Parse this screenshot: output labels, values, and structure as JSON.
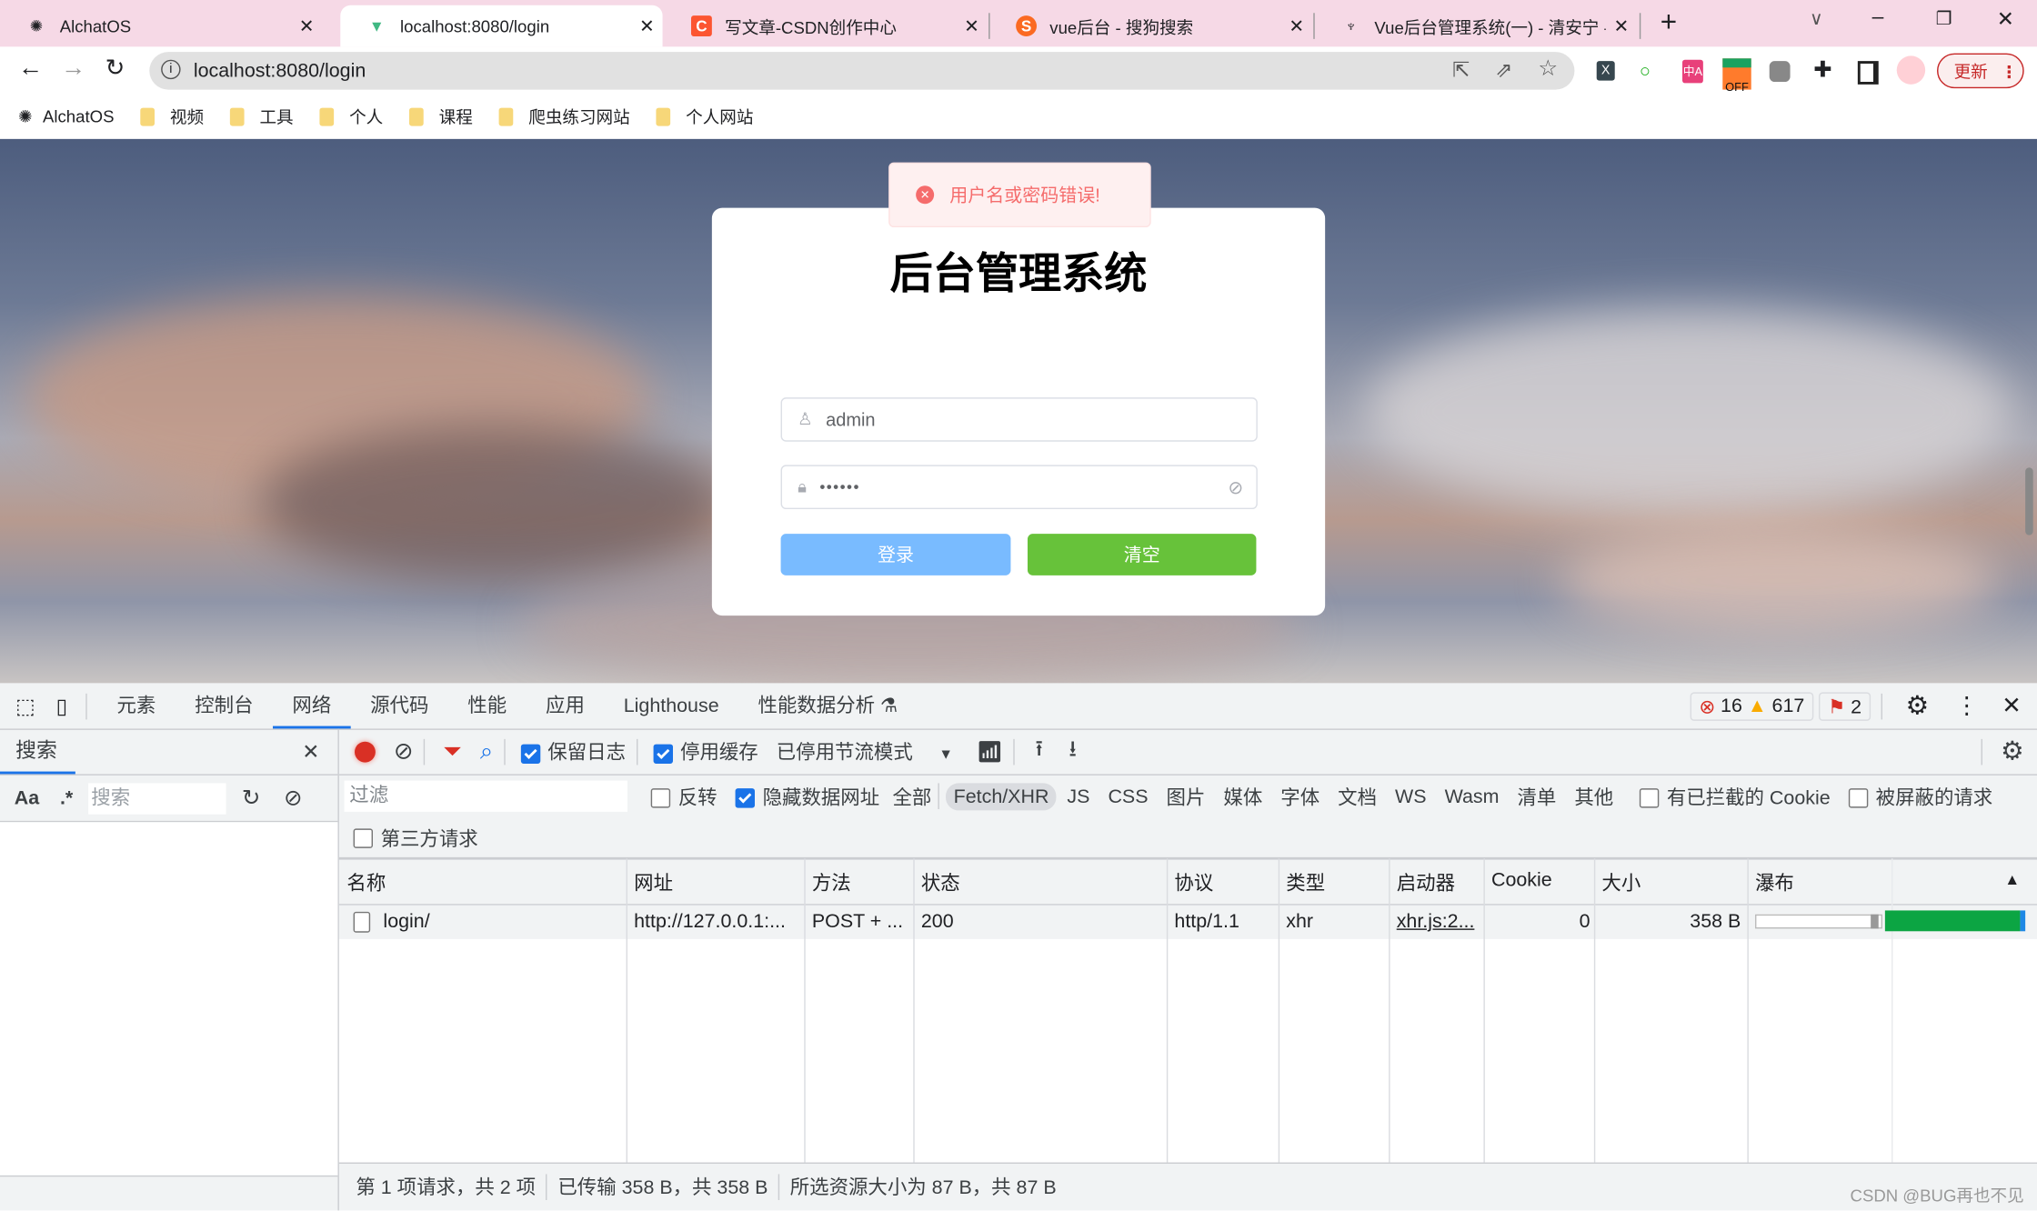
{
  "browser": {
    "tabs": [
      {
        "title": "AlchatOS",
        "icon": "openai-icon"
      },
      {
        "title": "localhost:8080/login",
        "icon": "vue-icon",
        "active": true
      },
      {
        "title": "写文章-CSDN创作中心",
        "icon": "csdn-icon"
      },
      {
        "title": "vue后台 - 搜狗搜索",
        "icon": "sogou-icon"
      },
      {
        "title": "Vue后台管理系统(一) - 清安宁 -",
        "icon": "bird-icon"
      }
    ],
    "url": "localhost:8080/login",
    "update_label": "更新",
    "extension_off_label": "OFF",
    "bookmarks": [
      {
        "label": "AlchatOS",
        "icon": "openai-icon"
      },
      {
        "label": "视频",
        "icon": "folder-icon"
      },
      {
        "label": "工具",
        "icon": "folder-icon"
      },
      {
        "label": "个人",
        "icon": "folder-icon"
      },
      {
        "label": "课程",
        "icon": "folder-icon"
      },
      {
        "label": "爬虫练习网站",
        "icon": "folder-icon"
      },
      {
        "label": "个人网站",
        "icon": "folder-icon"
      }
    ]
  },
  "login": {
    "toast": "用户名或密码错误!",
    "title": "后台管理系统",
    "username": "admin",
    "password": "••••••",
    "login_button": "登录",
    "clear_button": "清空",
    "colors": {
      "primary_light": "#79bbff",
      "success": "#67c23a",
      "error": "#f56c6c"
    }
  },
  "devtools": {
    "tabs": [
      "元素",
      "控制台",
      "网络",
      "源代码",
      "性能",
      "应用",
      "Lighthouse",
      "性能数据分析"
    ],
    "active_tab": "网络",
    "errors": "16",
    "warnings": "617",
    "issues": "2",
    "search": {
      "title": "搜索",
      "case_label": "Aa",
      "regex_label": ".*",
      "placeholder": "搜索"
    },
    "toolbar": {
      "preserve_log": "保留日志",
      "disable_cache": "停用缓存",
      "throttling": "已停用节流模式"
    },
    "filter": {
      "placeholder": "过滤",
      "invert": "反转",
      "hide_data_urls": "隐藏数据网址",
      "types": [
        "全部",
        "Fetch/XHR",
        "JS",
        "CSS",
        "图片",
        "媒体",
        "字体",
        "文档",
        "WS",
        "Wasm",
        "清单",
        "其他"
      ],
      "active_type": "Fetch/XHR",
      "blocked_cookies": "有已拦截的 Cookie",
      "blocked_requests": "被屏蔽的请求",
      "third_party": "第三方请求"
    },
    "table": {
      "columns": [
        "名称",
        "网址",
        "方法",
        "状态",
        "协议",
        "类型",
        "启动器",
        "Cookie",
        "大小",
        "瀑布"
      ],
      "rows": [
        [
          "login/",
          "http://127.0.0.1:...",
          "POST + ...",
          "200",
          "http/1.1",
          "xhr",
          "xhr.js:2...",
          "0",
          "358 B"
        ]
      ]
    },
    "status": [
      "第 1 项请求，共 2 项",
      "已传输 358 B，共 358 B",
      "所选资源大小为 87 B，共 87 B"
    ]
  },
  "watermark": "CSDN @BUG再也不见"
}
